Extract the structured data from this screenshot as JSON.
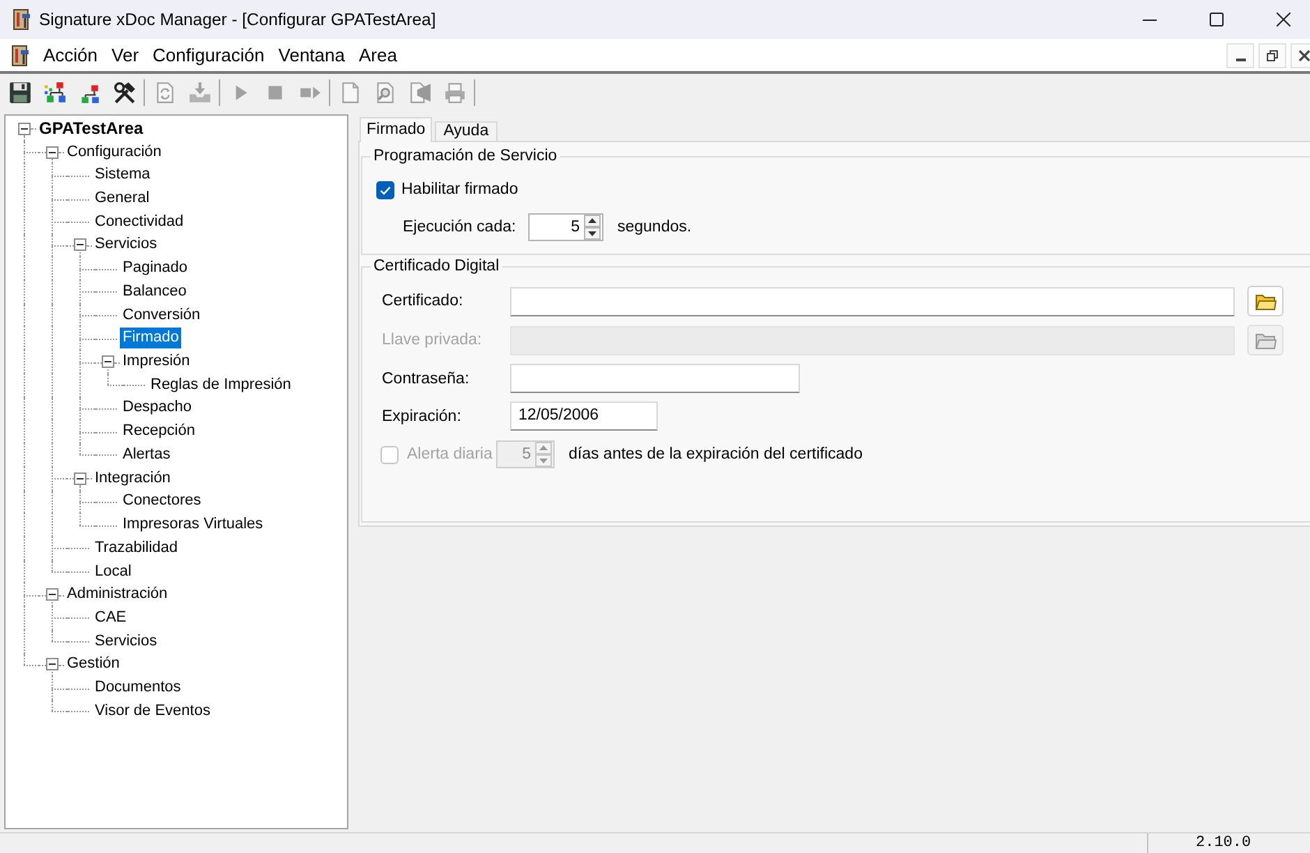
{
  "window": {
    "title": "Signature xDoc Manager - [Configurar GPATestArea]"
  },
  "menu_bar": {
    "items": [
      "Acción",
      "Ver",
      "Configuración",
      "Ventana",
      "Area"
    ]
  },
  "toolbar": {
    "groups": [
      [
        {
          "kind": "save",
          "disabled": false
        },
        {
          "kind": "hierarchy",
          "disabled": false
        },
        {
          "kind": "hierarchy_small",
          "disabled": false
        },
        {
          "kind": "tools",
          "disabled": false
        }
      ],
      [
        {
          "kind": "refresh",
          "disabled": true
        },
        {
          "kind": "tray_in",
          "disabled": true
        }
      ],
      [
        {
          "kind": "play",
          "disabled": true
        },
        {
          "kind": "stop",
          "disabled": true
        },
        {
          "kind": "step",
          "disabled": true
        }
      ],
      [
        {
          "kind": "page",
          "disabled": true
        },
        {
          "kind": "page_search",
          "disabled": true
        },
        {
          "kind": "page_speaker",
          "disabled": true
        },
        {
          "kind": "printer",
          "disabled": true
        }
      ]
    ]
  },
  "tree": {
    "items": [
      {
        "label": "GPATestArea",
        "selected": false,
        "expanded": true,
        "children": [
          {
            "label": "Configuración",
            "selected": false,
            "expanded": true,
            "children": [
              {
                "label": "Sistema",
                "selected": false
              },
              {
                "label": "General",
                "selected": false
              },
              {
                "label": "Conectividad",
                "selected": false
              },
              {
                "label": "Servicios",
                "selected": false,
                "expanded": true,
                "children": [
                  {
                    "label": "Paginado",
                    "selected": false
                  },
                  {
                    "label": "Balanceo",
                    "selected": false
                  },
                  {
                    "label": "Conversión",
                    "selected": false
                  },
                  {
                    "label": "Firmado",
                    "selected": true
                  },
                  {
                    "label": "Impresión",
                    "selected": false,
                    "expanded": true,
                    "children": [
                      {
                        "label": "Reglas de Impresión",
                        "selected": false
                      }
                    ]
                  },
                  {
                    "label": "Despacho",
                    "selected": false
                  },
                  {
                    "label": "Recepción",
                    "selected": false
                  },
                  {
                    "label": "Alertas",
                    "selected": false
                  }
                ]
              },
              {
                "label": "Integración",
                "selected": false,
                "expanded": true,
                "children": [
                  {
                    "label": "Conectores",
                    "selected": false
                  },
                  {
                    "label": "Impresoras Virtuales",
                    "selected": false
                  }
                ]
              },
              {
                "label": "Trazabilidad",
                "selected": false
              },
              {
                "label": "Local",
                "selected": false
              }
            ]
          },
          {
            "label": "Administración",
            "selected": false,
            "expanded": true,
            "children": [
              {
                "label": "CAE",
                "selected": false
              },
              {
                "label": "Servicios",
                "selected": false
              }
            ]
          },
          {
            "label": "Gestión",
            "selected": false,
            "expanded": true,
            "children": [
              {
                "label": "Documentos",
                "selected": false
              },
              {
                "label": "Visor de Eventos",
                "selected": false
              }
            ]
          }
        ]
      }
    ]
  },
  "tabs": [
    {
      "label": "Firmado",
      "selected": true
    },
    {
      "label": "Ayuda",
      "selected": false
    }
  ],
  "service_schedule": {
    "title": "Programación de Servicio",
    "enable_signing": {
      "label": "Habilitar firmado",
      "checked": true
    },
    "interval": {
      "label": "Ejecución cada:",
      "value": "5",
      "unit": "segundos."
    }
  },
  "digital_certificate": {
    "title": "Certificado Digital",
    "fields": [
      {
        "kind": "file",
        "label": "Certificado:",
        "disabled": false
      },
      {
        "kind": "file",
        "label": "Llave privada:",
        "disabled": true
      },
      {
        "kind": "password",
        "label": "Contraseña:",
        "disabled": false
      },
      {
        "kind": "date",
        "label": "Expiración:",
        "value": "12/05/2006",
        "disabled": false
      }
    ],
    "daily_alert": {
      "label": "Alerta diaria",
      "checked": false,
      "disabled": true,
      "value": "5",
      "suffix": "días antes de la expiración del certificado"
    }
  },
  "status_bar": {
    "version": "2.10.0"
  }
}
